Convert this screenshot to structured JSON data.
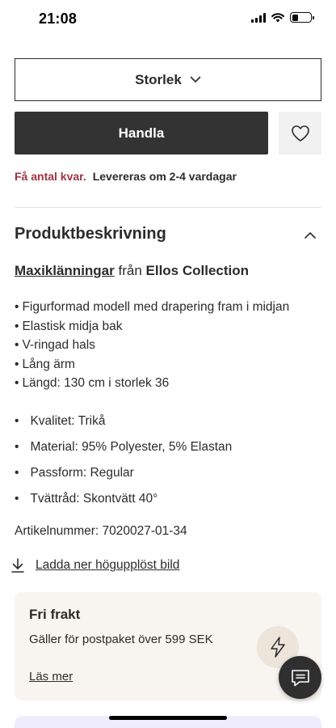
{
  "status_bar": {
    "time": "21:08",
    "battery_level": 0.35
  },
  "size_selector": {
    "label": "Storlek",
    "icon": "chevron-down-icon"
  },
  "buy_button": {
    "label": "Handla"
  },
  "wishlist": {
    "icon": "heart-icon"
  },
  "stock": {
    "low_stock": "Få antal kvar.",
    "delivery": "Levereras om 2-4 vardagar",
    "low_stock_color": "#a1323f"
  },
  "description": {
    "title": "Produktbeskrivning",
    "category_link": "Maxiklänningar",
    "from_text": " från ",
    "brand": "Ellos Collection",
    "features": [
      "Figurformad modell med drapering fram i midjan",
      "Elastisk midja bak",
      "V-ringad hals",
      "Lång ärm",
      "Längd: 130 cm i storlek 36"
    ],
    "specs": [
      "Kvalitet: Trikå",
      "Material: 95% Polyester, 5% Elastan",
      "Passform: Regular",
      "Tvättråd: Skontvätt 40°"
    ],
    "article_number": "Artikelnummer: 7020027-01-34",
    "download_label": "Ladda ner högupplöst bild"
  },
  "shipping": {
    "title": "Fri frakt",
    "description": "Gäller för postpaket över 599 SEK",
    "read_more": "Läs mer",
    "icon": "lightning-icon",
    "card_color": "#f8f4ef"
  },
  "chat": {
    "icon": "chat-bubble-icon"
  },
  "colors": {
    "primary_button": "#333333",
    "text": "#2b2b2b"
  }
}
